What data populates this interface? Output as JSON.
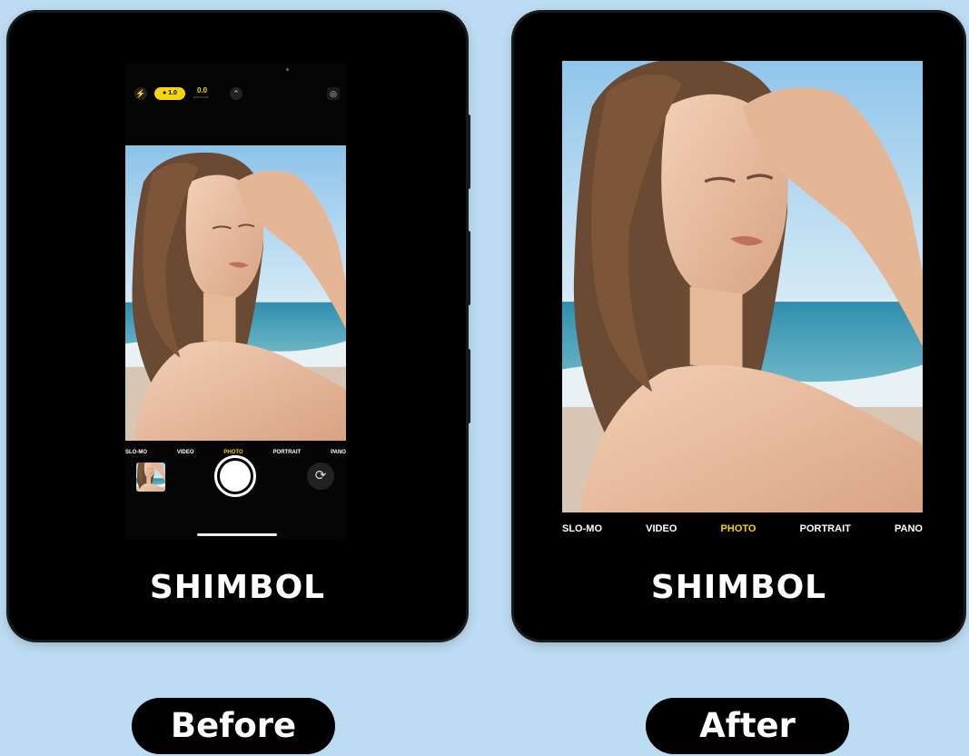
{
  "before": {
    "brand": "SHIMBOL",
    "label": "Before",
    "camera": {
      "flash_icon": "flash-icon",
      "zoom_pill": "1.0",
      "exposure_value": "0.0",
      "exposure_sub": "EXPOSURE",
      "chevron_icon": "chevron-up-icon",
      "live_icon": "live-photo-icon",
      "modes": [
        "SLO-MO",
        "VIDEO",
        "PHOTO",
        "PORTRAIT",
        "PANO"
      ],
      "active_mode": "PHOTO",
      "flip_icon": "camera-flip-icon"
    }
  },
  "after": {
    "brand": "SHIMBOL",
    "label": "After",
    "modes": [
      "SLO-MO",
      "VIDEO",
      "PHOTO",
      "PORTRAIT",
      "PANO"
    ],
    "active_mode": "PHOTO"
  },
  "colors": {
    "background": "#bcdcf3",
    "device": "#000000",
    "active_mode": "#f5d60a"
  }
}
